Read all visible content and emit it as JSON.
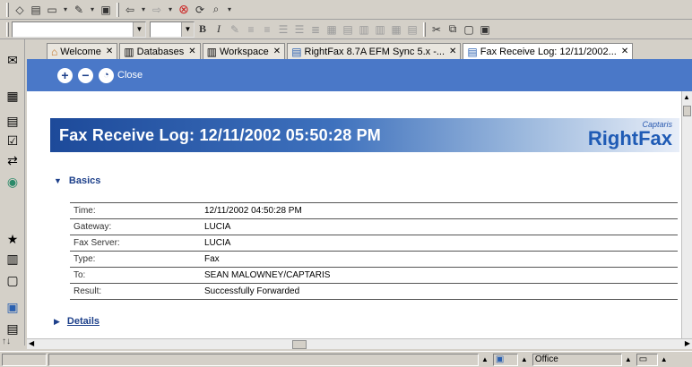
{
  "toolbar": {
    "icons": [
      "home-icon",
      "open-icon",
      "edit-icon",
      "screen-icon",
      "back-icon",
      "forward-icon",
      "stop-icon",
      "reload-icon",
      "search-icon"
    ]
  },
  "format_toolbar": {
    "bold": "B",
    "italic": "I"
  },
  "tabs": [
    {
      "label": "Welcome",
      "icon": "home-icon"
    },
    {
      "label": "Databases",
      "icon": "database-icon"
    },
    {
      "label": "Workspace",
      "icon": "workspace-icon"
    },
    {
      "label": "RightFax 8.7A EFM Sync 5.x -...",
      "icon": "document-icon"
    },
    {
      "label": "Fax Receive Log: 12/11/2002...",
      "icon": "fax-icon",
      "active": true
    }
  ],
  "actions": {
    "expand": "+",
    "collapse": "−",
    "close_label": "Close"
  },
  "banner": {
    "title": "Fax Receive Log: 12/11/2002 05:50:28 PM",
    "brand_small": "Captaris",
    "brand_big": "RightFax"
  },
  "basics": {
    "heading": "Basics",
    "rows": [
      {
        "key": "Time:",
        "value": "12/11/2002 04:50:28 PM"
      },
      {
        "key": "Gateway:",
        "value": "LUCIA"
      },
      {
        "key": "Fax Server:",
        "value": "LUCIA"
      },
      {
        "key": "Type:",
        "value": "Fax"
      },
      {
        "key": "To:",
        "value": "SEAN MALOWNEY/CAPTARIS"
      },
      {
        "key": "Result:",
        "value": "Successfully Forwarded"
      }
    ]
  },
  "details": {
    "heading": "Details"
  },
  "status": {
    "location": "Office"
  },
  "colors": {
    "action_bar": "#4a78c8",
    "heading": "#1c3f8a",
    "banner_dark": "#1d4a9a"
  }
}
